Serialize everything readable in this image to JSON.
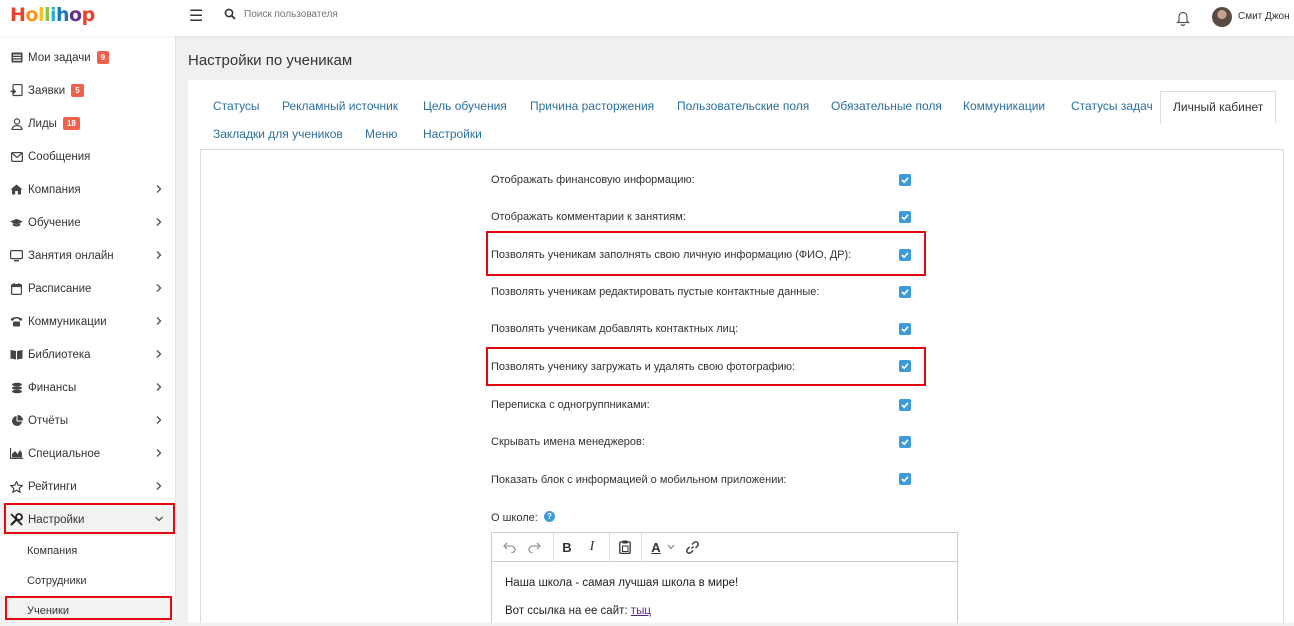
{
  "app": {
    "logo": "Hollihop",
    "search_placeholder": "Поиск пользователя",
    "user_name": "Смит Джон"
  },
  "sidebar": {
    "items": [
      {
        "label": "Мои задачи",
        "badge": "9",
        "icon": "tasks-icon"
      },
      {
        "label": "Заявки",
        "badge": "5",
        "icon": "user-add-icon"
      },
      {
        "label": "Лиды",
        "badge": "18",
        "icon": "user-icon"
      },
      {
        "label": "Сообщения",
        "icon": "envelope-icon"
      },
      {
        "label": "Компания",
        "icon": "home-icon"
      },
      {
        "label": "Обучение",
        "icon": "graduation-cap-icon"
      },
      {
        "label": "Занятия онлайн",
        "icon": "monitor-icon"
      },
      {
        "label": "Расписание",
        "icon": "calendar-icon"
      },
      {
        "label": "Коммуникации",
        "icon": "phone-icon"
      },
      {
        "label": "Библиотека",
        "icon": "book-icon"
      },
      {
        "label": "Финансы",
        "icon": "coins-icon"
      },
      {
        "label": "Отчёты",
        "icon": "pie-chart-icon"
      },
      {
        "label": "Специальное",
        "icon": "area-chart-icon"
      },
      {
        "label": "Рейтинги",
        "icon": "star-icon"
      },
      {
        "label": "Настройки",
        "icon": "tools-icon"
      }
    ],
    "subitems": [
      {
        "label": "Компания"
      },
      {
        "label": "Сотрудники"
      },
      {
        "label": "Ученики"
      }
    ]
  },
  "page": {
    "title": "Настройки по ученикам"
  },
  "tabs": [
    {
      "label": "Статусы"
    },
    {
      "label": "Рекламный источник"
    },
    {
      "label": "Цель обучения"
    },
    {
      "label": "Причина расторжения"
    },
    {
      "label": "Пользовательские поля"
    },
    {
      "label": "Обязательные поля"
    },
    {
      "label": "Коммуникации"
    },
    {
      "label": "Статусы задач"
    },
    {
      "label": "Личный кабинет",
      "active": true
    },
    {
      "label": "Закладки для учеников"
    },
    {
      "label": "Меню"
    },
    {
      "label": "Настройки"
    }
  ],
  "settings": [
    {
      "label": "Отображать финансовую информацию:",
      "checked": true
    },
    {
      "label": "Отображать комментарии к занятиям:",
      "checked": true
    },
    {
      "label": "Позволять ученикам заполнять свою личную информацию (ФИО, ДР):",
      "checked": true,
      "highlighted": true
    },
    {
      "label": "Позволять ученикам редактировать пустые контактные данные:",
      "checked": true
    },
    {
      "label": "Позволять ученикам добавлять контактных лиц:",
      "checked": true
    },
    {
      "label": "Позволять ученику загружать и удалять свою фотографию:",
      "checked": true,
      "highlighted": true
    },
    {
      "label": "Переписка с одногруппниками:",
      "checked": true
    },
    {
      "label": "Скрывать имена менеджеров:",
      "checked": true
    },
    {
      "label": "Показать блок с информацией о мобильном приложении:",
      "checked": true
    }
  ],
  "about": {
    "label": "О школе:",
    "help": "?",
    "toolbar": {
      "bold": "B",
      "italic": "I",
      "font_color": "A"
    },
    "line1": "Наша школа - самая лучшая школа в мире!",
    "line2_prefix": "Вот ссылка на ее сайт:",
    "line2_link": "тыц"
  },
  "colors": {
    "accent": "#3d9bd9",
    "link": "#2a6f9e",
    "badge": "#f0604c",
    "highlight": "#e3080f"
  }
}
